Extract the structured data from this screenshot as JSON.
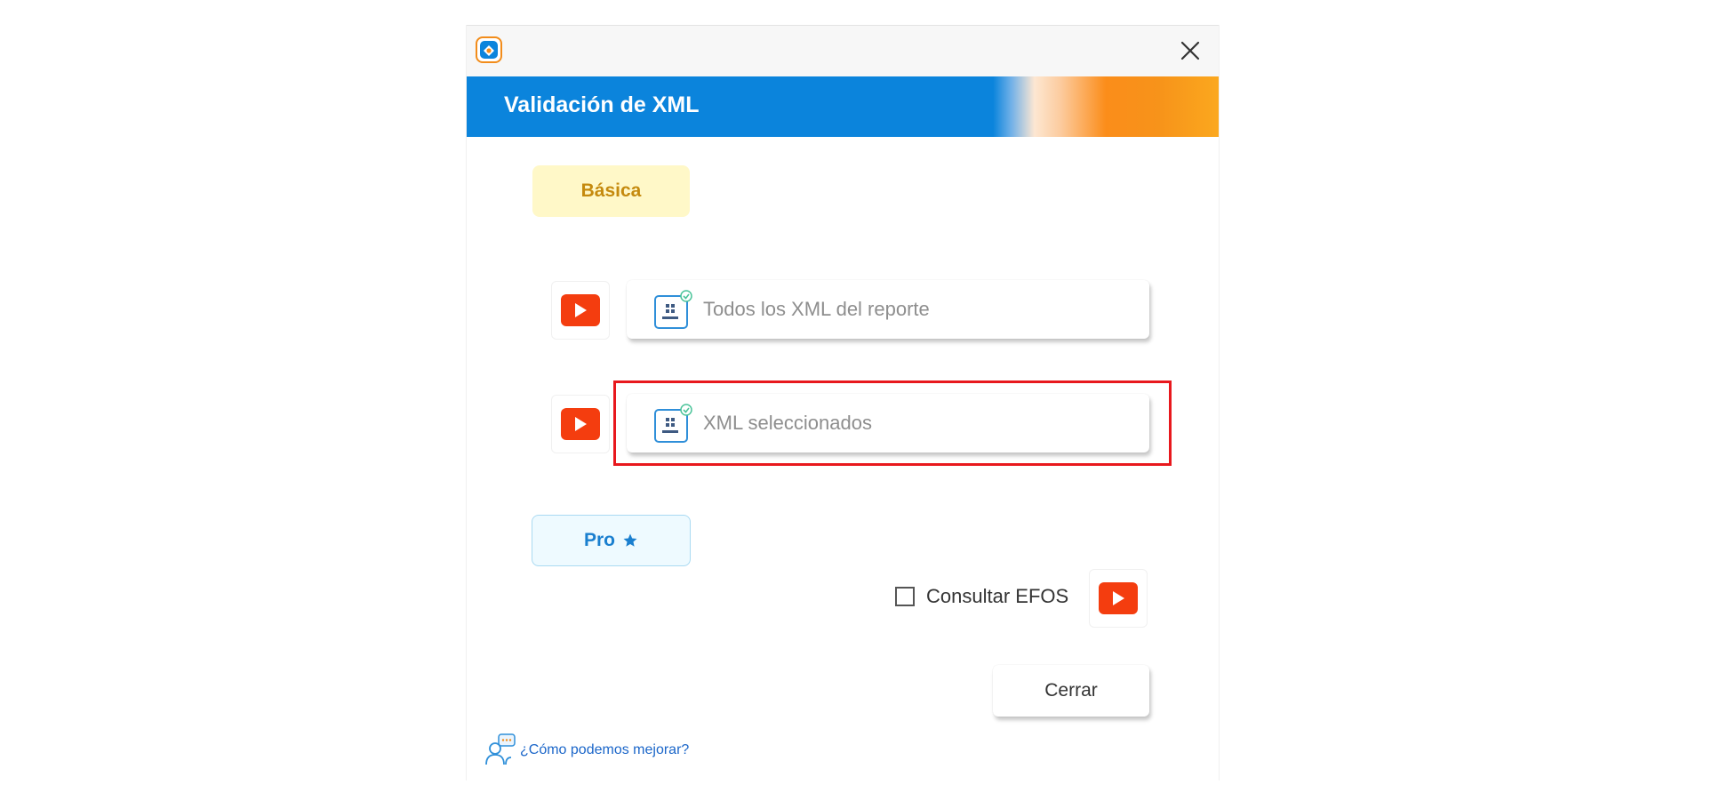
{
  "window": {
    "app_icon": "app-logo-icon",
    "close_icon": "close-icon"
  },
  "header": {
    "title": "Validación de XML",
    "colors": {
      "primary": "#0b84dc",
      "accent": "#f7931a"
    }
  },
  "basic_section": {
    "label": "Básica",
    "buttons": [
      {
        "label": "Todos los XML del reporte",
        "icon": "sat-document-icon",
        "video_icon": "youtube-play-icon"
      },
      {
        "label": "XML seleccionados",
        "icon": "sat-document-icon",
        "video_icon": "youtube-play-icon",
        "highlighted": true
      }
    ]
  },
  "pro_section": {
    "label": "Pro",
    "badge_icon": "star-icon",
    "efos_checkbox": {
      "label": "Consultar EFOS",
      "checked": false,
      "video_icon": "youtube-play-icon"
    }
  },
  "footer": {
    "close_button": "Cerrar",
    "feedback_link": "¿Cómo podemos mejorar?",
    "feedback_icon": "feedback-people-icon"
  }
}
